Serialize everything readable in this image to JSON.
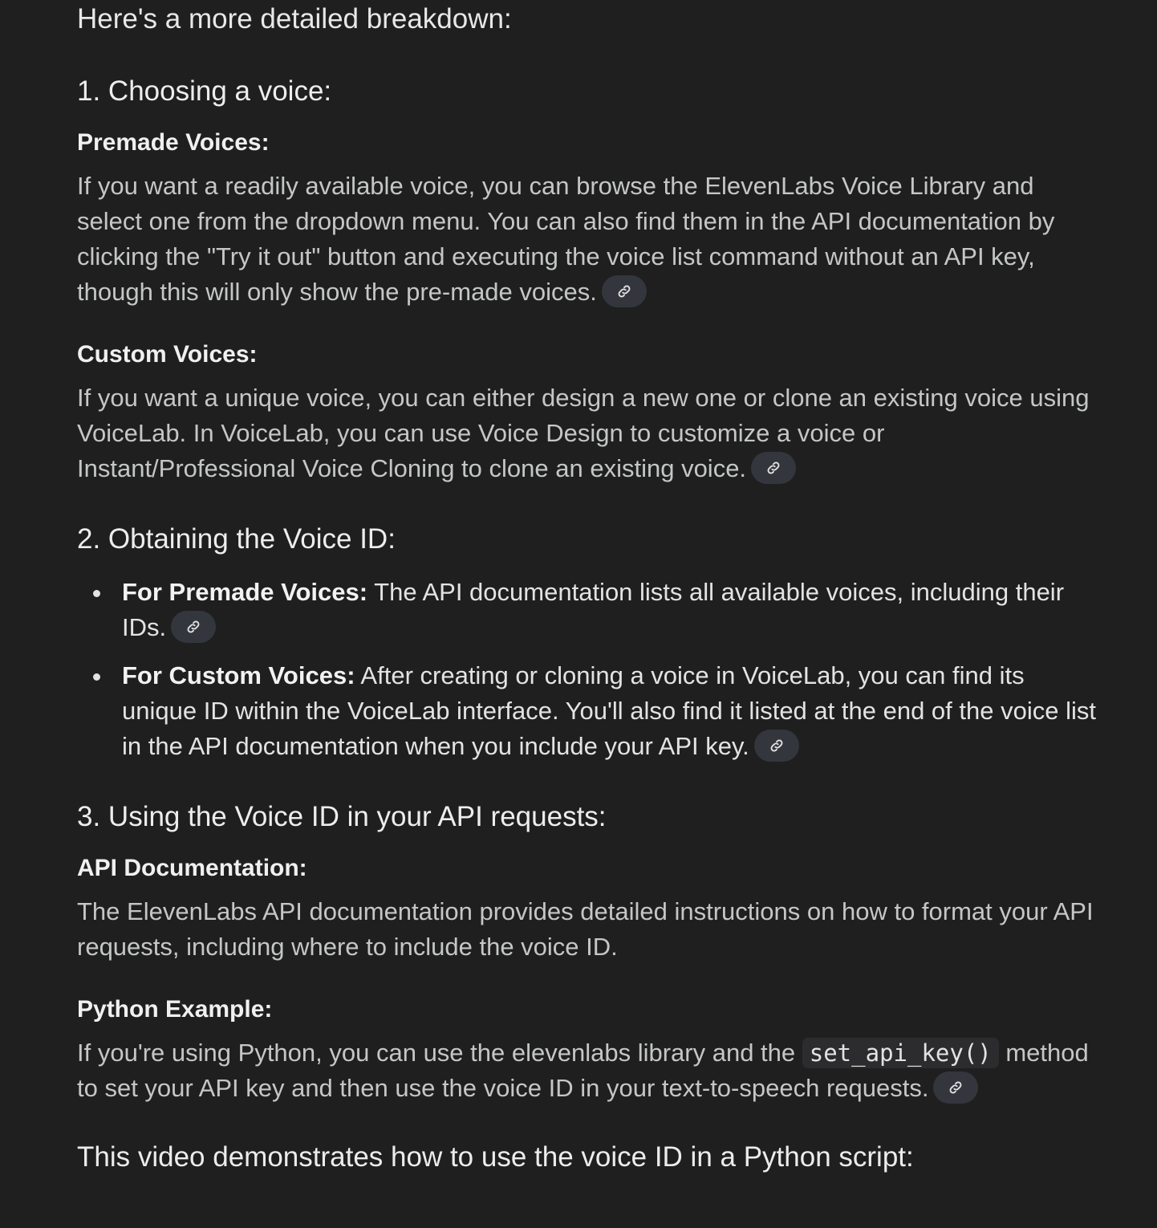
{
  "intro": "Here's a more detailed breakdown:",
  "sections": [
    {
      "title": "1. Choosing a voice:",
      "premade": {
        "title": "Premade Voices:",
        "text": "If you want a readily available voice, you can browse the ElevenLabs Voice Library and select one from the dropdown menu. You can also find them in the API documentation by clicking the \"Try it out\" button and executing the voice list command without an API key, though this will only show the pre-made voices."
      },
      "custom": {
        "title": "Custom Voices:",
        "text": "If you want a unique voice, you can either design a new one or clone an existing voice using VoiceLab. In VoiceLab, you can use Voice Design to customize a voice or Instant/Professional Voice Cloning to clone an existing voice."
      }
    },
    {
      "title": "2. Obtaining the Voice ID:",
      "bullets": [
        {
          "bold": "For Premade Voices:",
          "text": " The API documentation lists all available voices, including their IDs."
        },
        {
          "bold": "For Custom Voices:",
          "text": " After creating or cloning a voice in VoiceLab, you can find its unique ID within the VoiceLab interface. You'll also find it listed at the end of the voice list in the API documentation when you include your API key."
        }
      ]
    },
    {
      "title": "3. Using the Voice ID in your API requests:",
      "api_doc": {
        "title": "API Documentation:",
        "text": "The ElevenLabs API documentation provides detailed instructions on how to format your API requests, including where to include the voice ID."
      },
      "python": {
        "title": "Python Example:",
        "text_before": "If you're using Python, you can use the elevenlabs library and the ",
        "code": "set_api_key()",
        "text_after": " method to set your API key and then use the voice ID in your text-to-speech requests."
      }
    }
  ],
  "video_line": "This video demonstrates how to use the voice ID in a Python script:",
  "icons": {
    "source_link": "link-icon"
  },
  "colors": {
    "background": "#1f1f1f",
    "chip": "#33363d",
    "body_text": "#c4c7c5",
    "heading_text": "#ededed"
  }
}
